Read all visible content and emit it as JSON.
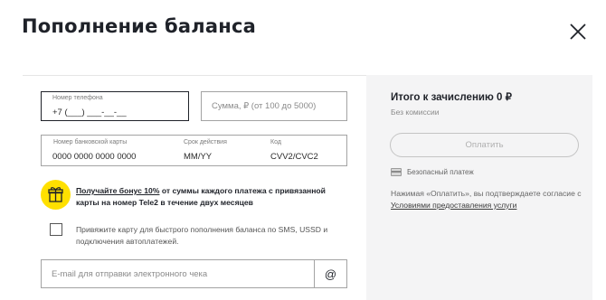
{
  "dialog": {
    "title": "Пополнение баланса",
    "close_icon": "close-icon"
  },
  "form": {
    "phone": {
      "label": "Номер телефона",
      "value": "+7 (___) ___-__-__"
    },
    "amount": {
      "placeholder": "Сумма, ₽ (от 100 до 5000)"
    },
    "card": {
      "number_label": "Номер банковской карты",
      "number_placeholder": "0000 0000 0000 0000",
      "expiry_label": "Срок действия",
      "expiry_placeholder": "MM/YY",
      "code_label": "Код",
      "code_placeholder": "CVV2/CVC2"
    },
    "bonus": {
      "icon": "gift-icon",
      "link_text": "Получайте бонус 10%",
      "text_rest": " от суммы каждого платежа с привязанной карты на номер ",
      "brand": "Tele2",
      "text_end": " в течение двух месяцев"
    },
    "bind_card": {
      "label": "Привяжите карту для быстрого пополнения баланса по SMS, USSD и подключения автоплатежей."
    },
    "email": {
      "placeholder": "E-mail для отправки электронного чека",
      "at_symbol": "@"
    }
  },
  "summary": {
    "total_label": "Итого к зачислению 0 ₽",
    "fee_note": "Без комиссии",
    "pay_button": "Оплатить",
    "secure_icon": "card-icon",
    "secure_label": "Безопасный платеж",
    "agree_text": "Нажимая «Оплатить», вы подтверждаете согласие с ",
    "terms_link": "Условиями предоставления услуги"
  },
  "colors": {
    "accent_yellow": "#ffe000",
    "panel_bg": "#f4f4f5",
    "text_dark": "#1f2229"
  }
}
